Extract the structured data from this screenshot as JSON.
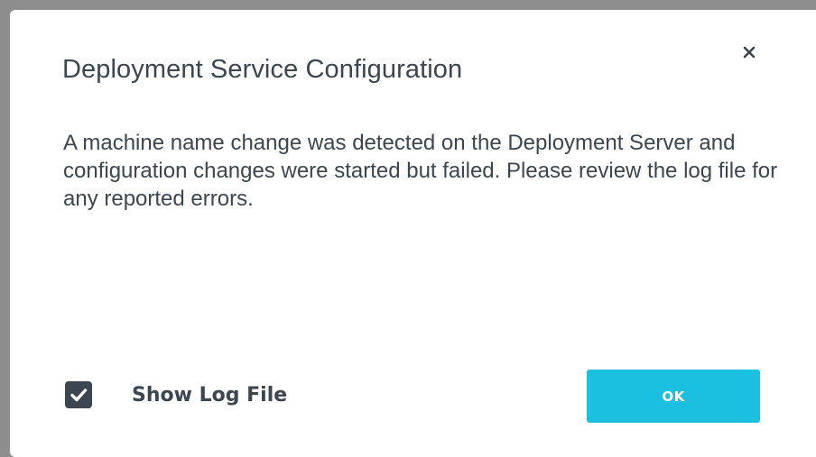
{
  "dialog": {
    "title": "Deployment Service Configuration",
    "message": "A machine name change was detected on the Deployment Server and configuration changes were started but failed. Please review the log file for any reported errors.",
    "close_icon": "close-icon",
    "checkbox": {
      "label": "Show Log File",
      "checked": true
    },
    "ok_label": "OK"
  },
  "colors": {
    "backdrop": "#8d8d8d",
    "dialog_background": "#ffffff",
    "text": "#3b4650",
    "primary_button": "#1bbfdf",
    "checkbox_fill": "#3b4650"
  }
}
